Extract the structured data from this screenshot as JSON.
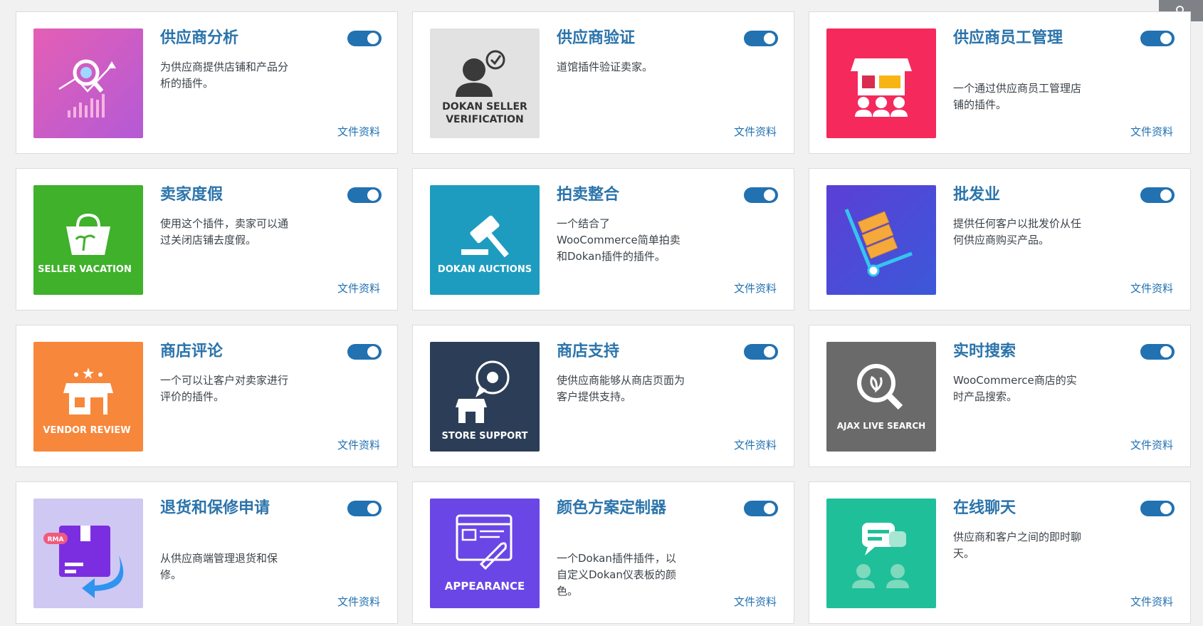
{
  "doc_link_label": "文件资料",
  "colors": {
    "title": "#2b74ab",
    "toggle_on": "#2271b1",
    "page_bg": "#f1f1f1"
  },
  "modules": [
    {
      "title": "供应商分析",
      "desc": "为供应商提供店铺和产品分析的插件。",
      "enabled": true,
      "icon": "analytics-chart-icon"
    },
    {
      "title": "供应商验证",
      "desc": "道馆插件验证卖家。",
      "enabled": true,
      "icon": "seller-verification-icon",
      "thumb_text": [
        "DOKAN SELLER",
        "VERIFICATION"
      ]
    },
    {
      "title": "供应商员工管理",
      "desc": "一个通过供应商员工管理店铺的插件。",
      "enabled": true,
      "icon": "store-staff-icon"
    },
    {
      "title": "卖家度假",
      "desc": "使用这个插件，卖家可以通过关闭店铺去度假。",
      "enabled": true,
      "icon": "vacation-bag-icon",
      "thumb_text": [
        "SELLER VACATION"
      ]
    },
    {
      "title": "拍卖整合",
      "desc": "一个结合了WooCommerce简单拍卖和Dokan插件的插件。",
      "enabled": true,
      "icon": "auction-gavel-icon",
      "thumb_text": [
        "DOKAN AUCTIONS"
      ]
    },
    {
      "title": "批发业",
      "desc": "提供任何客户以批发价从任何供应商购买产品。",
      "enabled": true,
      "icon": "wholesale-cart-icon"
    },
    {
      "title": "商店评论",
      "desc": "一个可以让客户对卖家进行评价的插件。",
      "enabled": true,
      "icon": "vendor-review-icon",
      "thumb_text": [
        "VENDOR REVIEW"
      ]
    },
    {
      "title": "商店支持",
      "desc": "使供应商能够从商店页面为客户提供支持。",
      "enabled": true,
      "icon": "store-support-icon",
      "thumb_text": [
        "STORE SUPPORT"
      ]
    },
    {
      "title": "实时搜索",
      "desc": "WooCommerce商店的实时产品搜索。",
      "enabled": true,
      "icon": "live-search-icon",
      "thumb_text": [
        "AJAX LIVE SEARCH"
      ]
    },
    {
      "title": "退货和保修申请",
      "desc": "从供应商端管理退货和保修。",
      "enabled": true,
      "icon": "rma-box-icon",
      "thumb_text": [
        "RMA"
      ]
    },
    {
      "title": "颜色方案定制器",
      "desc": "一个Dokan插件插件，以自定义Dokan仪表板的颜色。",
      "enabled": true,
      "icon": "appearance-icon",
      "thumb_text": [
        "APPEARANCE"
      ]
    },
    {
      "title": "在线聊天",
      "desc": "供应商和客户之间的即时聊天。",
      "enabled": true,
      "icon": "live-chat-icon"
    }
  ]
}
